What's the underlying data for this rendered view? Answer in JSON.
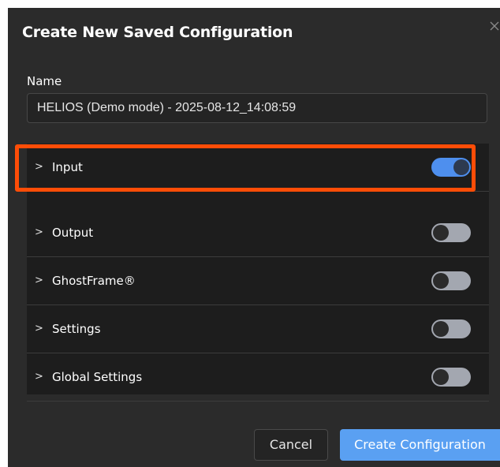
{
  "dialog": {
    "title": "Create New Saved Configuration",
    "close_icon": "close-icon"
  },
  "name_field": {
    "label": "Name",
    "value": "HELIOS (Demo mode) - 2025-08-12_14:08:59"
  },
  "sections": [
    {
      "label": "Input",
      "enabled": true,
      "highlighted": true
    },
    {
      "label": "Output",
      "enabled": false
    },
    {
      "label": "GhostFrame®",
      "enabled": false
    },
    {
      "label": "Settings",
      "enabled": false
    },
    {
      "label": "Global Settings",
      "enabled": false
    }
  ],
  "footer": {
    "cancel_label": "Cancel",
    "create_label": "Create Configuration"
  },
  "colors": {
    "dialog_bg": "#2b2b2b",
    "sections_bg": "#1d1d1d",
    "toggle_on": "#4e8fee",
    "toggle_off": "#a3a7b0",
    "primary_button": "#5aa0f2",
    "highlight": "#ff4d07"
  }
}
